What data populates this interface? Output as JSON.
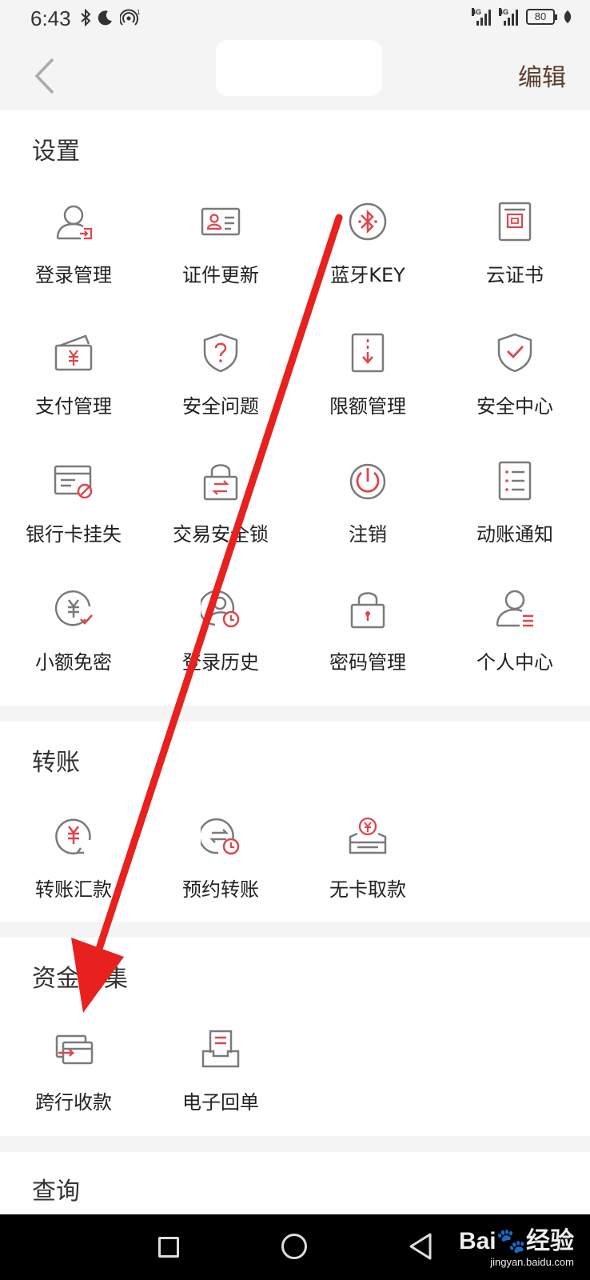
{
  "status": {
    "time": "6:43",
    "battery": "80",
    "signal1_label": "4G",
    "signal2_label": "4G",
    "hotspot_sup": "1"
  },
  "nav": {
    "edit_label": "编辑"
  },
  "sections": {
    "settings": {
      "title": "设置",
      "items": [
        {
          "label": "登录管理",
          "icon": "user-login-icon"
        },
        {
          "label": "证件更新",
          "icon": "id-card-icon"
        },
        {
          "label": "蓝牙KEY",
          "icon": "bluetooth-icon"
        },
        {
          "label": "云证书",
          "icon": "certificate-icon"
        },
        {
          "label": "支付管理",
          "icon": "wallet-yen-icon"
        },
        {
          "label": "安全问题",
          "icon": "shield-question-icon"
        },
        {
          "label": "限额管理",
          "icon": "limit-icon"
        },
        {
          "label": "安全中心",
          "icon": "shield-check-icon"
        },
        {
          "label": "银行卡挂失",
          "icon": "card-blocked-icon"
        },
        {
          "label": "交易安全锁",
          "icon": "lock-transfer-icon"
        },
        {
          "label": "注销",
          "icon": "power-icon"
        },
        {
          "label": "动账通知",
          "icon": "list-notice-icon"
        },
        {
          "label": "小额免密",
          "icon": "yen-check-icon"
        },
        {
          "label": "登录历史",
          "icon": "user-clock-icon"
        },
        {
          "label": "密码管理",
          "icon": "padlock-icon"
        },
        {
          "label": "个人中心",
          "icon": "user-profile-icon"
        }
      ]
    },
    "transfer": {
      "title": "转账",
      "items": [
        {
          "label": "转账汇款",
          "icon": "yen-transfer-icon"
        },
        {
          "label": "预约转账",
          "icon": "scheduled-transfer-icon"
        },
        {
          "label": "无卡取款",
          "icon": "cardless-withdraw-icon"
        }
      ]
    },
    "funds": {
      "title": "资金归集",
      "items": [
        {
          "label": "跨行收款",
          "icon": "cross-bank-card-icon"
        },
        {
          "label": "电子回单",
          "icon": "e-receipt-icon"
        }
      ]
    },
    "query": {
      "title": "查询"
    }
  },
  "watermark": {
    "brand": "Bai",
    "brand_suffix": "经验",
    "url": "jingyan.baidu.com"
  },
  "colors": {
    "accent": "#e0454b",
    "icon_gray": "#7a7a7a",
    "arrow": "#e8201e",
    "edit": "#5a3e2b"
  }
}
